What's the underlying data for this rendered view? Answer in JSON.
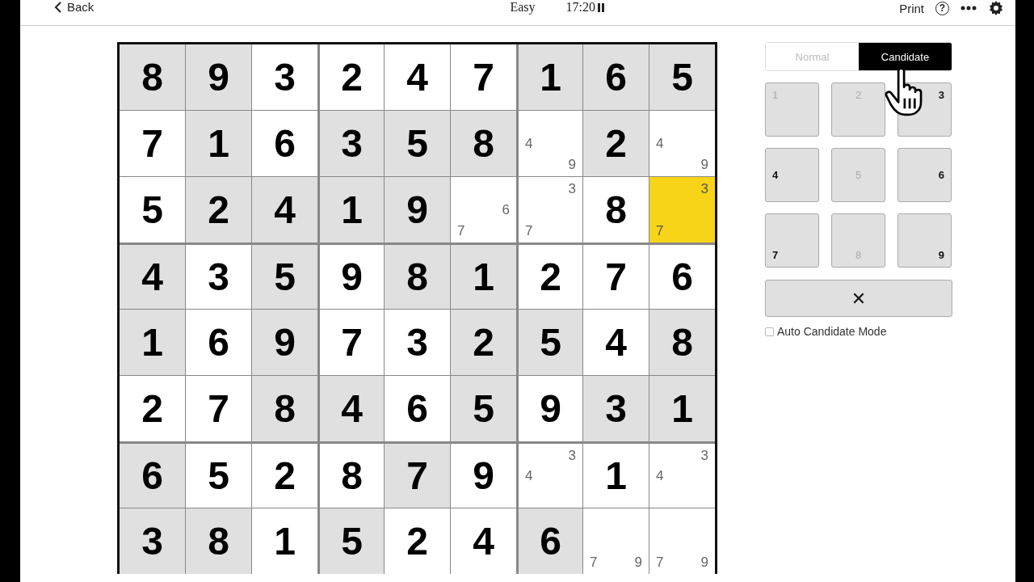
{
  "top_bar": {
    "back": "Back",
    "difficulty": "Easy",
    "timer": "17:20",
    "print": "Print",
    "help": "?"
  },
  "grid": {
    "rows": [
      {
        "cells": [
          {
            "value": "8",
            "given": true,
            "selected": false
          },
          {
            "value": "9",
            "given": true,
            "selected": false
          },
          {
            "value": "3",
            "given": false,
            "selected": false
          },
          {
            "value": "2",
            "given": false,
            "selected": false
          },
          {
            "value": "4",
            "given": false,
            "selected": false
          },
          {
            "value": "7",
            "given": false,
            "selected": false
          },
          {
            "value": "1",
            "given": true,
            "selected": false
          },
          {
            "value": "6",
            "given": true,
            "selected": false
          },
          {
            "value": "5",
            "given": true,
            "selected": false
          }
        ]
      },
      {
        "cells": [
          {
            "value": "7",
            "given": false,
            "selected": false
          },
          {
            "value": "1",
            "given": true,
            "selected": false
          },
          {
            "value": "6",
            "given": false,
            "selected": false
          },
          {
            "value": "3",
            "given": true,
            "selected": false
          },
          {
            "value": "5",
            "given": true,
            "selected": false
          },
          {
            "value": "8",
            "given": true,
            "selected": false
          },
          {
            "candidates": [
              "4",
              "9"
            ],
            "given": false,
            "selected": false
          },
          {
            "value": "2",
            "given": true,
            "selected": false
          },
          {
            "candidates": [
              "4",
              "9"
            ],
            "given": false,
            "selected": false
          }
        ]
      },
      {
        "cells": [
          {
            "value": "5",
            "given": false,
            "selected": false
          },
          {
            "value": "2",
            "given": true,
            "selected": false
          },
          {
            "value": "4",
            "given": true,
            "selected": false
          },
          {
            "value": "1",
            "given": true,
            "selected": false
          },
          {
            "value": "9",
            "given": true,
            "selected": false
          },
          {
            "candidates": [
              "6",
              "7"
            ],
            "given": false,
            "selected": false
          },
          {
            "candidates": [
              "3",
              "7"
            ],
            "given": false,
            "selected": false
          },
          {
            "value": "8",
            "given": false,
            "selected": false
          },
          {
            "candidates": [
              "3",
              "7"
            ],
            "given": false,
            "selected": true
          }
        ]
      },
      {
        "cells": [
          {
            "value": "4",
            "given": true,
            "selected": false
          },
          {
            "value": "3",
            "given": false,
            "selected": false
          },
          {
            "value": "5",
            "given": true,
            "selected": false
          },
          {
            "value": "9",
            "given": false,
            "selected": false
          },
          {
            "value": "8",
            "given": true,
            "selected": false
          },
          {
            "value": "1",
            "given": true,
            "selected": false
          },
          {
            "value": "2",
            "given": false,
            "selected": false
          },
          {
            "value": "7",
            "given": false,
            "selected": false
          },
          {
            "value": "6",
            "given": false,
            "selected": false
          }
        ]
      },
      {
        "cells": [
          {
            "value": "1",
            "given": true,
            "selected": false
          },
          {
            "value": "6",
            "given": false,
            "selected": false
          },
          {
            "value": "9",
            "given": true,
            "selected": false
          },
          {
            "value": "7",
            "given": false,
            "selected": false
          },
          {
            "value": "3",
            "given": false,
            "selected": false
          },
          {
            "value": "2",
            "given": true,
            "selected": false
          },
          {
            "value": "5",
            "given": true,
            "selected": false
          },
          {
            "value": "4",
            "given": false,
            "selected": false
          },
          {
            "value": "8",
            "given": true,
            "selected": false
          }
        ]
      },
      {
        "cells": [
          {
            "value": "2",
            "given": false,
            "selected": false
          },
          {
            "value": "7",
            "given": false,
            "selected": false
          },
          {
            "value": "8",
            "given": true,
            "selected": false
          },
          {
            "value": "4",
            "given": true,
            "selected": false
          },
          {
            "value": "6",
            "given": false,
            "selected": false
          },
          {
            "value": "5",
            "given": true,
            "selected": false
          },
          {
            "value": "9",
            "given": false,
            "selected": false
          },
          {
            "value": "3",
            "given": true,
            "selected": false
          },
          {
            "value": "1",
            "given": true,
            "selected": false
          }
        ]
      },
      {
        "cells": [
          {
            "value": "6",
            "given": true,
            "selected": false
          },
          {
            "value": "5",
            "given": false,
            "selected": false
          },
          {
            "value": "2",
            "given": false,
            "selected": false
          },
          {
            "value": "8",
            "given": false,
            "selected": false
          },
          {
            "value": "7",
            "given": true,
            "selected": false
          },
          {
            "value": "9",
            "given": false,
            "selected": false
          },
          {
            "candidates": [
              "3",
              "4"
            ],
            "given": false,
            "selected": false
          },
          {
            "value": "1",
            "given": false,
            "selected": false
          },
          {
            "candidates": [
              "3",
              "4"
            ],
            "given": false,
            "selected": false
          }
        ]
      },
      {
        "cells": [
          {
            "value": "3",
            "given": true,
            "selected": false
          },
          {
            "value": "8",
            "given": true,
            "selected": false
          },
          {
            "value": "1",
            "given": false,
            "selected": false
          },
          {
            "value": "5",
            "given": true,
            "selected": false
          },
          {
            "value": "2",
            "given": false,
            "selected": false
          },
          {
            "value": "4",
            "given": false,
            "selected": false
          },
          {
            "value": "6",
            "given": true,
            "selected": false
          },
          {
            "candidates": [
              "7",
              "9"
            ],
            "given": false,
            "selected": false
          },
          {
            "candidates": [
              "7",
              "9"
            ],
            "given": false,
            "selected": false
          }
        ]
      }
    ]
  },
  "modes": [
    {
      "label": "Normal",
      "selected": false
    },
    {
      "label": "Candidate",
      "selected": true
    }
  ],
  "keypad": [
    {
      "label": "1",
      "disabled": true
    },
    {
      "label": "2",
      "disabled": true
    },
    {
      "label": "3",
      "disabled": false
    },
    {
      "label": "4",
      "disabled": false
    },
    {
      "label": "5",
      "disabled": true
    },
    {
      "label": "6",
      "disabled": false
    },
    {
      "label": "7",
      "disabled": false
    },
    {
      "label": "8",
      "disabled": true
    },
    {
      "label": "9",
      "disabled": false
    }
  ],
  "erase": {
    "label": "✕"
  },
  "auto_candidate": {
    "label": "Auto Candidate Mode",
    "checked": false
  }
}
